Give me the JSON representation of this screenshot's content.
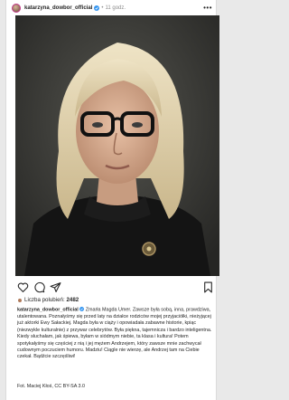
{
  "post": {
    "username": "katarzyna_dowbor_official",
    "time_separator": "•",
    "time": "11 godz.",
    "likes_label": "Liczba polubień:",
    "likes_count": "2482",
    "caption_username": "katarzyna_dowbor_official",
    "caption_text": "Zmarła Magda Umer. Zawsze była sobą, inna, prawdziwa, utalentowana. Poznałyśmy się przed laty na działce rodziców mojej przyjaciółki, nieżyjącej już aktorki Ewy Sałackiej. Magda była w ciąży i opowiadała zabawne historie, kpiąc (niezwykle kulturalnie) z przywar celebrytów. Była piękna, tajemnicza i bardzo inteligentna. Kiedy słuchałam, jak śpiewa, byłam w siódmym niebie, ta klasa i kultura! Potem spotykałyśmy się częściej z nią i jej mężem Andrzejem, który zawsze mnie zachwycał cudownym poczuciem humoru. Madziu! Ciągle nie wierzę, ale Andrzej tam na Ciebie czekał. Bądźcie szczęśliwi!",
    "photo_credit": "Fot. Maciej Kłoś, CC BY-SA 3.0"
  },
  "colors": {
    "verified": "#3897f0",
    "text": "#262626",
    "muted": "#8e8e8e"
  }
}
